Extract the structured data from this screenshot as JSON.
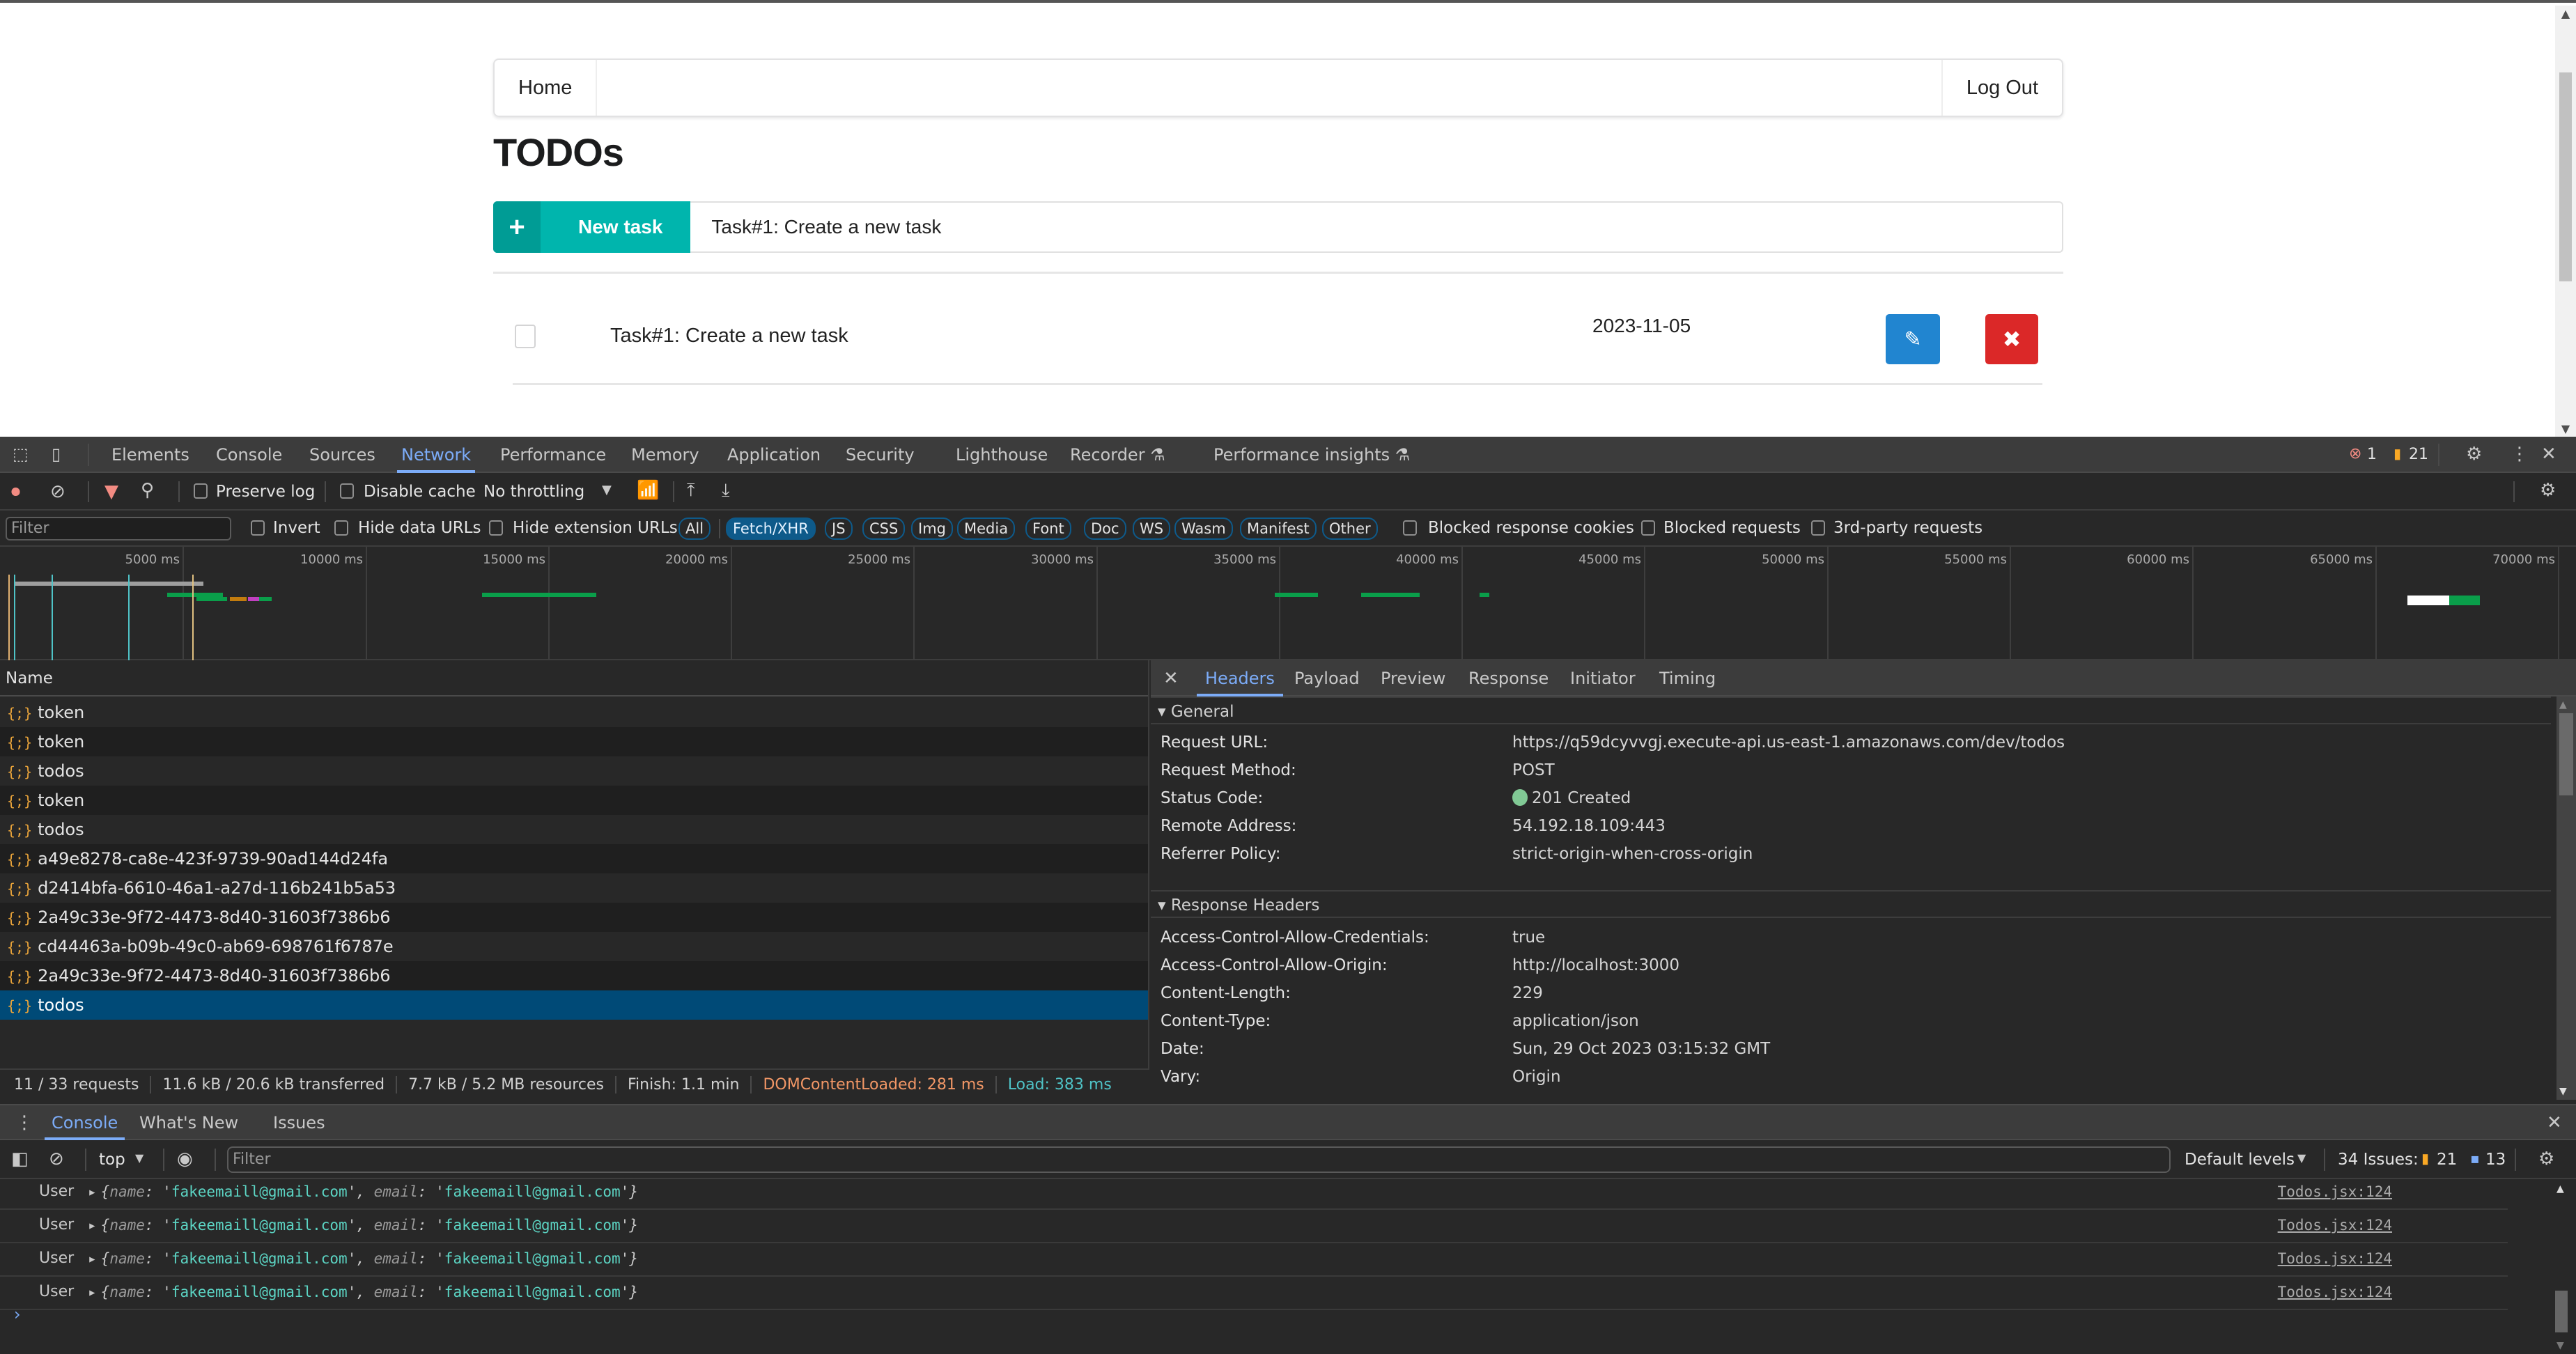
{
  "page": {
    "nav": {
      "home": "Home",
      "logout": "Log Out"
    },
    "title": "TODOs",
    "new_task": {
      "button_label": "New task",
      "icon": "plus-icon",
      "input_value": "Task#1: Create a new task"
    },
    "tasks": [
      {
        "name": "Task#1: Create a new task",
        "due_date": "2023-11-05",
        "done": false,
        "edit_icon": "pencil-icon",
        "delete_icon": "close-icon"
      }
    ]
  },
  "devtools": {
    "tabs": [
      "Elements",
      "Console",
      "Sources",
      "Network",
      "Performance",
      "Memory",
      "Application",
      "Security",
      "Lighthouse",
      "Recorder",
      "Performance insights"
    ],
    "active_tab": "Network",
    "error_count": "1",
    "warning_count": "21",
    "network_toolbar": {
      "preserve_log": "Preserve log",
      "disable_cache": "Disable cache",
      "throttling": "No throttling"
    },
    "filter": {
      "placeholder": "Filter",
      "invert": "Invert",
      "hide_data_urls": "Hide data URLs",
      "hide_extension_urls": "Hide extension URLs",
      "types": [
        "All",
        "Fetch/XHR",
        "JS",
        "CSS",
        "Img",
        "Media",
        "Font",
        "Doc",
        "WS",
        "Wasm",
        "Manifest",
        "Other"
      ],
      "active_type": "Fetch/XHR",
      "blocked_response_cookies": "Blocked response cookies",
      "blocked_requests": "Blocked requests",
      "third_party": "3rd-party requests"
    },
    "timeline": {
      "ticks": [
        "5000 ms",
        "10000 ms",
        "15000 ms",
        "20000 ms",
        "25000 ms",
        "30000 ms",
        "35000 ms",
        "40000 ms",
        "45000 ms",
        "50000 ms",
        "55000 ms",
        "60000 ms",
        "65000 ms",
        "70000 ms"
      ]
    },
    "requests": {
      "column_name": "Name",
      "rows": [
        "token",
        "token",
        "todos",
        "token",
        "todos",
        "a49e8278-ca8e-423f-9739-90ad144d24fa",
        "d2414bfa-6610-46a1-a27d-116b241b5a53",
        "2a49c33e-9f72-4473-8d40-31603f7386b6",
        "cd44463a-b09b-49c0-ab69-698761f6787e",
        "2a49c33e-9f72-4473-8d40-31603f7386b6",
        "todos"
      ],
      "selected_index": 10
    },
    "status_bar": {
      "requests": "11 / 33 requests",
      "transferred": "11.6 kB / 20.6 kB transferred",
      "resources": "7.7 kB / 5.2 MB resources",
      "finish": "Finish: 1.1 min",
      "dom_content_loaded": "DOMContentLoaded: 281 ms",
      "load": "Load: 383 ms"
    },
    "detail": {
      "tabs": [
        "Headers",
        "Payload",
        "Preview",
        "Response",
        "Initiator",
        "Timing"
      ],
      "active_tab": "Headers",
      "general_title": "General",
      "general": [
        {
          "k": "Request URL:",
          "v": "https://q59dcyvvgj.execute-api.us-east-1.amazonaws.com/dev/todos"
        },
        {
          "k": "Request Method:",
          "v": "POST"
        },
        {
          "k": "Status Code:",
          "v": "201 Created"
        },
        {
          "k": "Remote Address:",
          "v": "54.192.18.109:443"
        },
        {
          "k": "Referrer Policy:",
          "v": "strict-origin-when-cross-origin"
        }
      ],
      "response_title": "Response Headers",
      "response": [
        {
          "k": "Access-Control-Allow-Credentials:",
          "v": "true"
        },
        {
          "k": "Access-Control-Allow-Origin:",
          "v": "http://localhost:3000"
        },
        {
          "k": "Content-Length:",
          "v": "229"
        },
        {
          "k": "Content-Type:",
          "v": "application/json"
        },
        {
          "k": "Date:",
          "v": "Sun, 29 Oct 2023 03:15:32 GMT"
        },
        {
          "k": "Vary:",
          "v": "Origin"
        }
      ]
    },
    "drawer": {
      "tabs": [
        "Console",
        "What's New",
        "Issues"
      ],
      "active_tab": "Console",
      "context": "top",
      "filter_placeholder": "Filter",
      "levels": "Default levels",
      "issues_label": "34 Issues:",
      "issues_warnings": "21",
      "issues_info": "13",
      "logs": [
        {
          "label": "User",
          "name": "fakeemaill@gmail.com",
          "email": "fakeemaill@gmail.com",
          "source": "Todos.jsx:124"
        },
        {
          "label": "User",
          "name": "fakeemaill@gmail.com",
          "email": "fakeemaill@gmail.com",
          "source": "Todos.jsx:124"
        },
        {
          "label": "User",
          "name": "fakeemaill@gmail.com",
          "email": "fakeemaill@gmail.com",
          "source": "Todos.jsx:124"
        },
        {
          "label": "User",
          "name": "fakeemaill@gmail.com",
          "email": "fakeemaill@gmail.com",
          "source": "Todos.jsx:124"
        }
      ]
    }
  }
}
